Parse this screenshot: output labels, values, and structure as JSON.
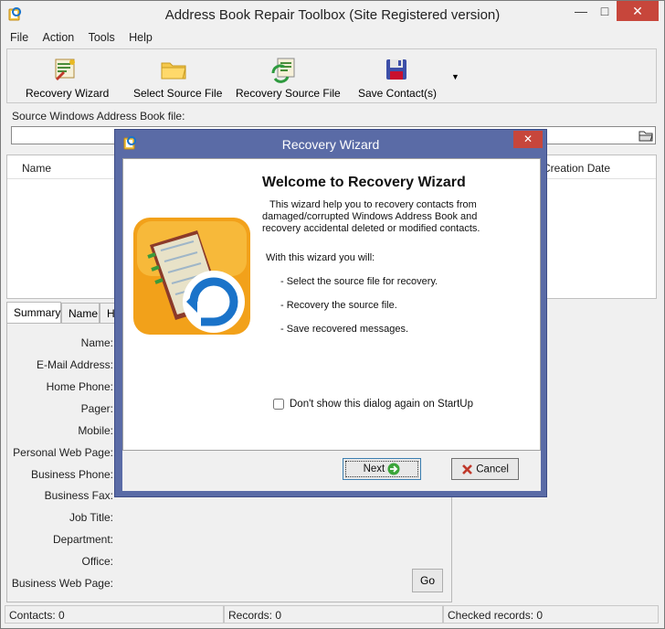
{
  "window": {
    "title": "Address Book Repair Toolbox (Site Registered version)",
    "min_glyph": "—",
    "max_glyph": "□",
    "close_glyph": "✕"
  },
  "menu": [
    "File",
    "Action",
    "Tools",
    "Help"
  ],
  "toolbar": {
    "recovery_wizard": "Recovery Wizard",
    "select_source_file": "Select Source File",
    "recovery_source_file": "Recovery Source File",
    "save_contacts": "Save Contact(s)",
    "more_glyph": "▼"
  },
  "source": {
    "label": "Source Windows Address Book file:",
    "value": ""
  },
  "list": {
    "columns": [
      "Name",
      "Creation Date"
    ]
  },
  "tabs": [
    "Summary",
    "Name",
    "Ho"
  ],
  "details": {
    "fields": [
      "Name:",
      "E-Mail Address:",
      "Home Phone:",
      "Pager:",
      "Mobile:",
      "Personal Web Page:",
      "Business Phone:",
      "Business Fax:",
      "Job Title:",
      "Department:",
      "Office:",
      "Business Web Page:"
    ],
    "go_label": "Go"
  },
  "status": {
    "contacts": "Contacts: 0",
    "records": "Records: 0",
    "checked": "Checked records: 0"
  },
  "dialog": {
    "title": "Recovery Wizard",
    "close_glyph": "✕",
    "heading": "Welcome to Recovery Wizard",
    "intro_1": "This wizard help you to recovery contacts from",
    "intro_2": "damaged/corrupted Windows Address Book and",
    "intro_3": "recovery accidental deleted or modified contacts.",
    "with_wizard": "With this wizard you will:",
    "steps": [
      "- Select the source file for recovery.",
      "- Recovery the source file.",
      "- Save recovered messages."
    ],
    "dont_show": "Don't show this dialog again on StartUp",
    "next_label": "Next",
    "cancel_label": "Cancel"
  },
  "colors": {
    "dialog_frame": "#5a6ba6",
    "close_red": "#c7463b",
    "wizard_orange": "#f2a11a",
    "wizard_blue": "#1a73c9"
  }
}
